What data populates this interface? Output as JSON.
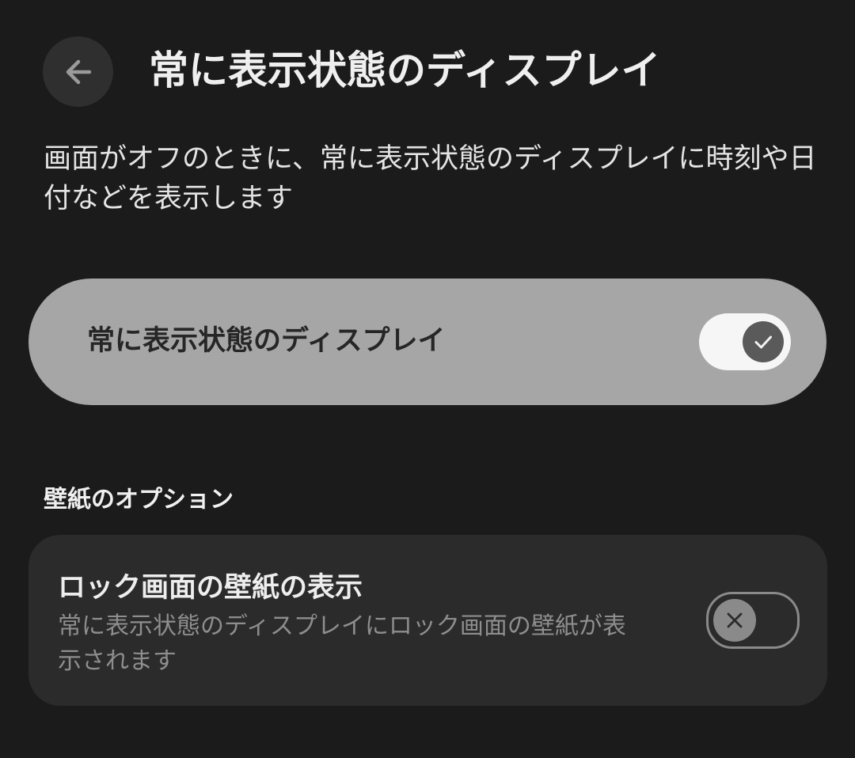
{
  "header": {
    "title": "常に表示状態のディスプレイ",
    "back_icon": "arrow-back-icon"
  },
  "description": "画面がオフのときに、常に表示状態のディスプレイに時刻や日付などを表示します",
  "main_toggle": {
    "label": "常に表示状態のディスプレイ",
    "state": "on",
    "icon": "check-icon"
  },
  "wallpaper_section": {
    "header": "壁紙のオプション",
    "item": {
      "title": "ロック画面の壁紙の表示",
      "description": "常に表示状態のディスプレイにロック画面の壁紙が表示されます",
      "state": "off",
      "icon": "close-icon"
    }
  },
  "colors": {
    "background": "#1b1b1b",
    "toggle_card": "#a6a6a6",
    "card": "#2b2b2b",
    "switch_on_track": "#f6f6f6",
    "switch_on_thumb": "#5a5a5a",
    "switch_off_thumb": "#8a8a8a"
  }
}
